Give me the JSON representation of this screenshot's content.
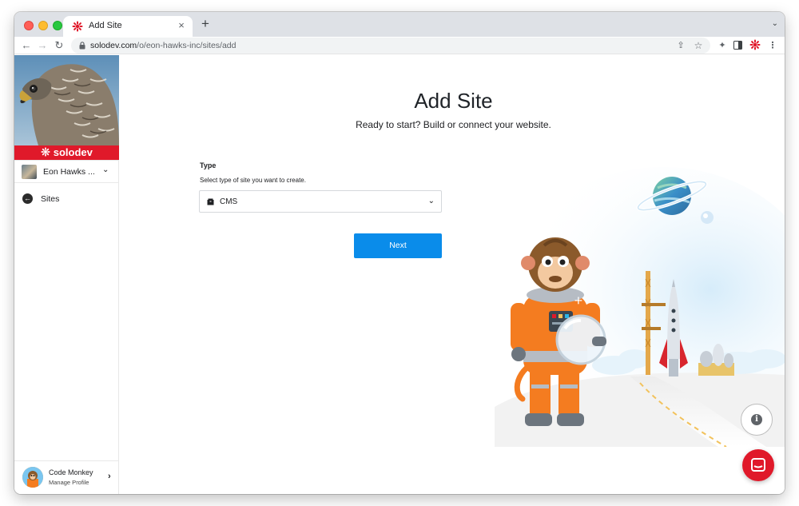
{
  "browser": {
    "tab_title": "Add Site",
    "tab_close": "×",
    "new_tab": "+",
    "tab_menu": "⌄",
    "url_host": "solodev.com",
    "url_path": "/o/eon-hawks-inc/sites/add"
  },
  "sidebar": {
    "brand": "solodev",
    "org_name": "Eon Hawks ...",
    "nav_item": "Sites",
    "profile_name": "Code Monkey",
    "profile_sub": "Manage Profile"
  },
  "main": {
    "title": "Add Site",
    "subtitle": "Ready to start? Build or connect your website.",
    "type_label": "Type",
    "type_help": "Select type of site you want to create.",
    "type_value": "CMS",
    "next_label": "Next"
  },
  "colors": {
    "brand_red": "#e0192a",
    "primary_blue": "#0a8cea",
    "suit_orange": "#f47c20"
  },
  "icons": {
    "lock": "lock-icon",
    "share": "share-icon",
    "star": "star-icon",
    "extensions": "puzzle-icon",
    "side_panel": "side-panel-icon",
    "menu": "kebab-menu-icon",
    "info": "info-icon",
    "chat": "chat-icon"
  }
}
